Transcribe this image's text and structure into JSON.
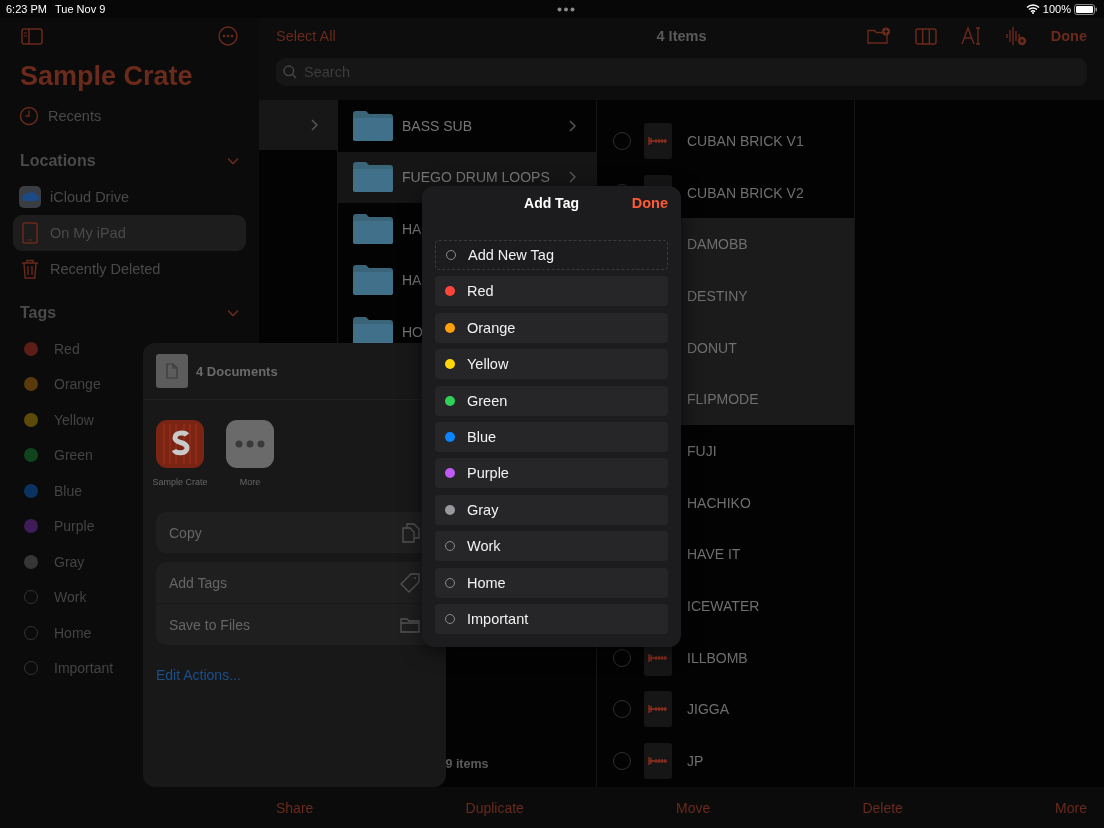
{
  "status_bar": {
    "time": "6:23 PM",
    "date": "Tue Nov 9",
    "battery": "100%"
  },
  "sidebar": {
    "title": "Sample Crate",
    "recents": "Recents",
    "locations": {
      "heading": "Locations",
      "items": [
        {
          "label": "iCloud Drive",
          "kind": "cloud",
          "selected": false
        },
        {
          "label": "On My iPad",
          "kind": "ipad",
          "selected": true
        },
        {
          "label": "Recently Deleted",
          "kind": "trash",
          "selected": false
        }
      ]
    },
    "tags": {
      "heading": "Tags",
      "items": [
        {
          "label": "Red",
          "color": "#5c1c18"
        },
        {
          "label": "Orange",
          "color": "#5a3a0c"
        },
        {
          "label": "Yellow",
          "color": "#5a4b0a"
        },
        {
          "label": "Green",
          "color": "#10441c"
        },
        {
          "label": "Blue",
          "color": "#0c3262"
        },
        {
          "label": "Purple",
          "color": "#3e1c58"
        },
        {
          "label": "Gray",
          "color": "#363636"
        },
        {
          "label": "Work"
        },
        {
          "label": "Home"
        },
        {
          "label": "Important"
        }
      ]
    }
  },
  "nav": {
    "select_all": "Select All",
    "title": "4 Items",
    "done": "Done"
  },
  "search": {
    "placeholder": "Search"
  },
  "folders": {
    "items": [
      {
        "name": "BASS SUB",
        "selected": false
      },
      {
        "name": "FUEGO DRUM LOOPS",
        "selected": true
      },
      {
        "name": "HA",
        "selected": false
      },
      {
        "name": "HA",
        "selected": false
      },
      {
        "name": "HO",
        "selected": false
      }
    ],
    "footer": "9 items"
  },
  "files": [
    {
      "name": "CUBAN BRICK V1",
      "selected": false
    },
    {
      "name": "CUBAN BRICK V2",
      "selected": false
    },
    {
      "name": "DAMOBB",
      "selected": true
    },
    {
      "name": "DESTINY",
      "selected": true
    },
    {
      "name": "DONUT",
      "selected": true
    },
    {
      "name": "FLIPMODE",
      "selected": true
    },
    {
      "name": "FUJI",
      "selected": false
    },
    {
      "name": "HACHIKO",
      "selected": false
    },
    {
      "name": "HAVE IT",
      "selected": false
    },
    {
      "name": "ICEWATER",
      "selected": false
    },
    {
      "name": "ILLBOMB",
      "selected": false
    },
    {
      "name": "JIGGA",
      "selected": false
    },
    {
      "name": "JP",
      "selected": false
    }
  ],
  "toolbar": [
    "Share",
    "Duplicate",
    "Move",
    "Delete",
    "More"
  ],
  "share_sheet": {
    "title": "4 Documents",
    "apps": [
      {
        "label": "Sample Crate",
        "kind": "app"
      },
      {
        "label": "More",
        "kind": "more"
      }
    ],
    "action_groups": [
      [
        {
          "label": "Copy",
          "kind": "copy"
        }
      ],
      [
        {
          "label": "Add Tags",
          "kind": "tag"
        },
        {
          "label": "Save to Files",
          "kind": "folder"
        }
      ]
    ],
    "edit_link": "Edit Actions..."
  },
  "add_tag": {
    "title": "Add Tag",
    "done": "Done",
    "new_tag": "Add New Tag",
    "tags": [
      {
        "label": "Red",
        "color": "#ff453a"
      },
      {
        "label": "Orange",
        "color": "#ff9f0a"
      },
      {
        "label": "Yellow",
        "color": "#ffd60a"
      },
      {
        "label": "Green",
        "color": "#30d158"
      },
      {
        "label": "Blue",
        "color": "#0a84ff"
      },
      {
        "label": "Purple",
        "color": "#bf5af2"
      },
      {
        "label": "Gray",
        "color": "#98989d"
      },
      {
        "label": "Work"
      },
      {
        "label": "Home"
      },
      {
        "label": "Important"
      }
    ]
  }
}
